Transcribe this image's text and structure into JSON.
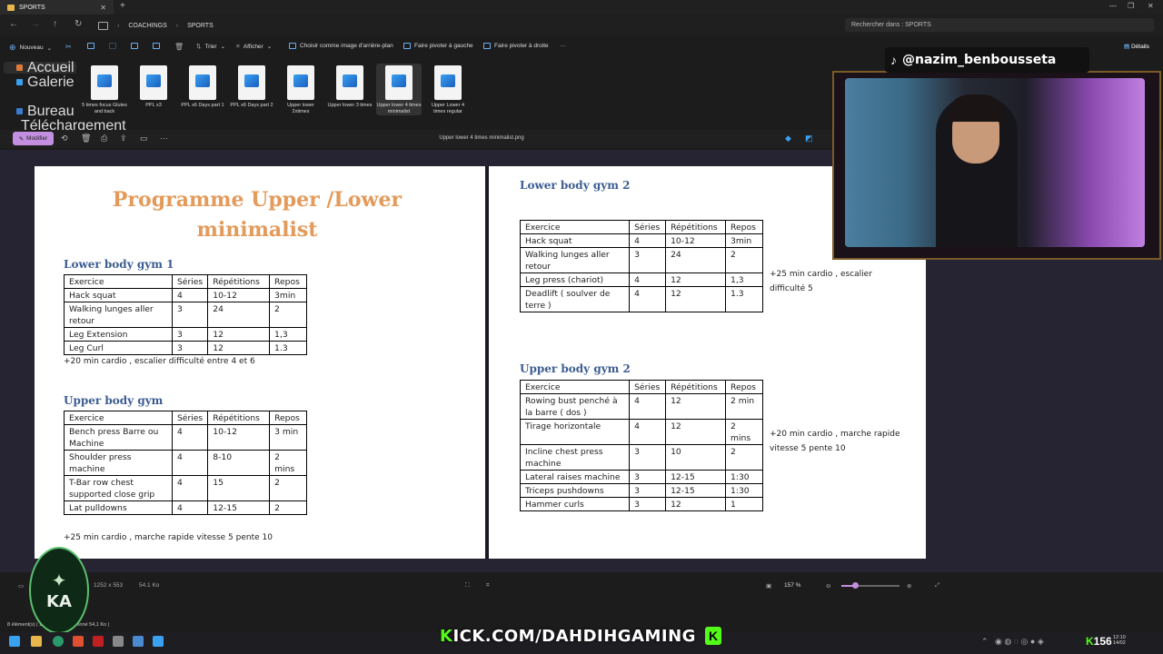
{
  "window": {
    "tab_title": "SPORTS",
    "new_tab": "+",
    "controls": [
      "—",
      "❐",
      "✕"
    ]
  },
  "address": {
    "crumbs": [
      "COACHINGS",
      "SPORTS"
    ],
    "search_placeholder": "Rechercher dans : SPORTS"
  },
  "toolbar": {
    "new": "Nouveau",
    "sort": "Trier",
    "view": "Afficher",
    "set_background": "Choisir comme image d'arrière-plan",
    "rotate_left": "Faire pivoter à gauche",
    "rotate_right": "Faire pivoter à droite",
    "more": "···",
    "details": "Détails"
  },
  "leftnav": [
    "Accueil",
    "Galerie",
    "Bureau",
    "Téléchargement"
  ],
  "files": [
    {
      "name": "5 times focus Glutes and back"
    },
    {
      "name": "PPL x3"
    },
    {
      "name": "PPL x6 Days part 1"
    },
    {
      "name": "PPL x6 Days part 2"
    },
    {
      "name": "Upper lower 2xtimes"
    },
    {
      "name": "Upper lower 3 times"
    },
    {
      "name": "Upper lower 4 times minimalist"
    },
    {
      "name": "Upper Lower 4 times regular"
    }
  ],
  "viewer": {
    "edit_label": "Modifier",
    "file_name": "Upper lower 4 times minimalist.png",
    "dims": "1252 x 553",
    "size": "54.1 Ko",
    "zoom": "157 %"
  },
  "doc": {
    "title_line1": "Programme Upper /Lower",
    "title_line2": "minimalist",
    "headers": [
      "Exercice",
      "Séries",
      "Répétitions",
      "Repos"
    ],
    "lower1": {
      "title": "Lower body gym 1",
      "rows": [
        [
          "Hack squat",
          "4",
          "10-12",
          "3min"
        ],
        [
          "Walking lunges aller retour",
          "3",
          "24",
          "2"
        ],
        [
          "Leg Extension",
          "3",
          "12",
          "1,3"
        ],
        [
          "Leg Curl",
          "3",
          "12",
          "1.3"
        ]
      ],
      "note": "+20 min cardio , escalier difficulté entre 4 et 6"
    },
    "upper1": {
      "title": "Upper body gym",
      "rows": [
        [
          "Bench press Barre ou Machine",
          "4",
          "10-12",
          "3 min"
        ],
        [
          "Shoulder press machine",
          "4",
          "8-10",
          "2 mins"
        ],
        [
          "T-Bar row chest supported close grip",
          "4",
          "15",
          "2"
        ],
        [
          "Lat pulldowns",
          "4",
          "12-15",
          "2"
        ]
      ],
      "note": "+25 min cardio , marche rapide vitesse 5 pente 10"
    },
    "lower2": {
      "title": "Lower body gym 2",
      "rows": [
        [
          "Hack squat",
          "4",
          "10-12",
          "3min"
        ],
        [
          "Walking lunges aller retour",
          "3",
          "24",
          "2"
        ],
        [
          "Leg press (chariot)",
          "4",
          "12",
          "1,3"
        ],
        [
          "Deadlift ( soulver de terre )",
          "4",
          "12",
          "1.3"
        ]
      ],
      "note": "+25 min cardio , escalier difficulté 5"
    },
    "upper2": {
      "title": "Upper body gym 2",
      "rows": [
        [
          "Rowing bust penché à la barre ( dos )",
          "4",
          "12",
          "2 min"
        ],
        [
          "Tirage horizontale",
          "4",
          "12",
          "2 mins"
        ],
        [
          "Incline chest press machine",
          "3",
          "10",
          "2"
        ],
        [
          "Lateral raises machine",
          "3",
          "12-15",
          "1:30"
        ],
        [
          "Triceps pushdowns",
          "3",
          "12-15",
          "1:30"
        ],
        [
          "Hammer curls",
          "3",
          "12",
          "1"
        ]
      ],
      "note": "+20 min cardio , marche rapide vitesse 5 pente 10"
    }
  },
  "overlay": {
    "handle": "@nazim_benbousseta",
    "kick_prefix": "K",
    "kick_text": "ICK.COM/DAHDIHGAMING",
    "kick_badge": "K",
    "viewers": "156",
    "logo": "KA"
  },
  "status": "8 élément(s) | 1 élément sélectionné  54,1 Ko |",
  "clock": {
    "time": "12:10",
    "date": "14/02"
  }
}
